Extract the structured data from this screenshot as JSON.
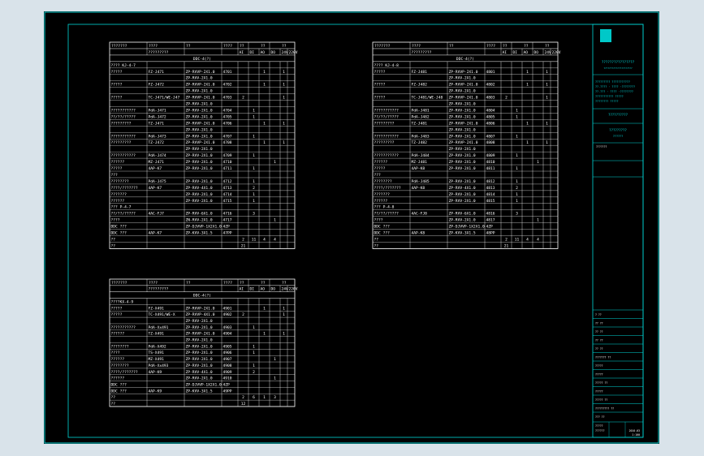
{
  "colors": {
    "frame_bg": "#d9e3ea",
    "sheet_bg": "#000000",
    "border": "#00d8d8",
    "lines": "#ffffff",
    "title_text": "#00e0e0",
    "logo_bg": "#00c8c8"
  },
  "tables": [
    {
      "id": "t1",
      "header": [
        "???????",
        "????",
        "??",
        "????",
        "??",
        "??",
        "??"
      ],
      "subheader": [
        "",
        "?????????",
        "",
        "",
        "AI",
        "DI",
        "AO",
        "DO",
        "24V",
        "220V"
      ],
      "section": "DDC-4(?)",
      "rows": [
        [
          "???? KJ-4-7",
          "",
          "",
          "",
          "",
          "",
          "",
          "",
          "",
          ""
        ],
        [
          "?????",
          "FZ-J471",
          "ZP-RVVP-2X1.0",
          "4701",
          "",
          "",
          "1",
          "",
          "1",
          ""
        ],
        [
          "",
          "",
          "ZP-RVV-2X1.0",
          "",
          "",
          "",
          "",
          "",
          "",
          ""
        ],
        [
          "?????",
          "FZ-J472",
          "ZP-RVVP-2X1.0",
          "4702",
          "",
          "",
          "1",
          "",
          "1",
          ""
        ],
        [
          "",
          "",
          "ZP-RVV-2X1.0",
          "",
          "",
          "",
          "",
          "",
          "",
          ""
        ],
        [
          "?????",
          "TC-J471/WE-J47",
          "ZP-RVVP-2X1.0",
          "4703",
          "2",
          "",
          "",
          "",
          "1",
          ""
        ],
        [
          "",
          "",
          "ZP-RVV-2X1.0",
          "",
          "",
          "",
          "",
          "",
          "",
          ""
        ],
        [
          "???????????",
          "PdA-J471",
          "ZP-RVV-2X1.0",
          "4704",
          "",
          "1",
          "",
          "",
          "",
          ""
        ],
        [
          "??/??/?????",
          "PdA-J472",
          "ZP-RVV-2X1.0",
          "4705",
          "",
          "1",
          "",
          "",
          "",
          ""
        ],
        [
          "?????????",
          "TZ-J471",
          "ZP-RVVP-2X1.0",
          "4706",
          "",
          "",
          "1",
          "",
          "1",
          ""
        ],
        [
          "",
          "",
          "ZP-RVV-2X1.0",
          "",
          "",
          "",
          "",
          "",
          "",
          ""
        ],
        [
          "???????????",
          "PdA-J473",
          "ZP-RVV-2X1.0",
          "4707",
          "",
          "1",
          "",
          "",
          "",
          ""
        ],
        [
          "?????????",
          "TZ-J472",
          "ZP-RVVP-2X1.0",
          "4708",
          "",
          "",
          "1",
          "",
          "1",
          ""
        ],
        [
          "",
          "",
          "ZP-RVV-2X1.0",
          "",
          "",
          "",
          "",
          "",
          "",
          ""
        ],
        [
          "???????????",
          "PdA-J474",
          "ZP-RVV-2X1.0",
          "4709",
          "",
          "1",
          "",
          "",
          "",
          ""
        ],
        [
          "??????",
          "MZ-J471",
          "ZP-RVV-2X1.0",
          "4710",
          "",
          "",
          "",
          "1",
          "",
          ""
        ],
        [
          "?????",
          "4AP-K7",
          "ZP-RVV-2X1.0",
          "4711",
          "",
          "1",
          "",
          "",
          "",
          ""
        ],
        [
          "???",
          "",
          "",
          "",
          "",
          "",
          "",
          "",
          "",
          ""
        ],
        [
          "????????",
          "PdA-J475",
          "ZP-RVV-2X1.0",
          "4712",
          "",
          "1",
          "",
          "",
          "",
          ""
        ],
        [
          "????/???????",
          "4AP-K7",
          "ZP-RVV-4X1.0",
          "4713",
          "",
          "2",
          "",
          "",
          "",
          ""
        ],
        [
          "???????",
          "",
          "ZP-RVV-2X1.0",
          "4714",
          "",
          "1",
          "",
          "",
          "",
          ""
        ],
        [
          "??????",
          "",
          "ZP-RVV-2X1.0",
          "4715",
          "",
          "1",
          "",
          "",
          "",
          ""
        ],
        [
          "??? P-4-7",
          "",
          "",
          "",
          "",
          "",
          "",
          "",
          "",
          ""
        ],
        [
          "??/??/?????",
          "4AC-FJ7",
          "ZP-RVV-6X1.0",
          "4716",
          "",
          "3",
          "",
          "",
          "",
          ""
        ],
        [
          "????",
          "",
          "ZN-RVV-2X1.0",
          "4717",
          "",
          "",
          "",
          "1",
          "",
          ""
        ],
        [
          "DDC ???",
          "",
          "ZP-DJVVP-1X2X1.0",
          "4ZP",
          "",
          "",
          "",
          "",
          "",
          ""
        ],
        [
          "DDC ???",
          "4AP-K7",
          "ZP-KVV-3X1.5",
          "47PP",
          "",
          "",
          "",
          "",
          "",
          ""
        ],
        [
          "??",
          "",
          "",
          "",
          "2",
          "11",
          "4",
          "4",
          "",
          ""
        ],
        [
          "??",
          "",
          "",
          "",
          "21",
          "",
          "",
          "",
          "",
          ""
        ]
      ]
    },
    {
      "id": "t2",
      "header": [
        "???????",
        "????",
        "??",
        "????",
        "??",
        "??",
        "??"
      ],
      "subheader": [
        "",
        "?????????",
        "",
        "",
        "AI",
        "DI",
        "AO",
        "DO",
        "24V",
        "220V"
      ],
      "section": "DDC-4(?)",
      "rows": [
        [
          "???? KJ-4-8",
          "",
          "",
          "",
          "",
          "",
          "",
          "",
          "",
          ""
        ],
        [
          "?????",
          "FZ-J481",
          "ZP-RVVP-2X1.0",
          "4801",
          "",
          "",
          "1",
          "",
          "1",
          ""
        ],
        [
          "",
          "",
          "ZP-RVV-2X1.0",
          "",
          "",
          "",
          "",
          "",
          "",
          ""
        ],
        [
          "?????",
          "FZ-J482",
          "ZP-RVVP-2X1.0",
          "4802",
          "",
          "",
          "1",
          "",
          "1",
          ""
        ],
        [
          "",
          "",
          "ZP-RVV-2X1.0",
          "",
          "",
          "",
          "",
          "",
          "",
          ""
        ],
        [
          "?????",
          "TC-J481/WE-J48",
          "ZP-RVVP-2X1.0",
          "4803",
          "2",
          "",
          "",
          "",
          "1",
          ""
        ],
        [
          "",
          "",
          "ZP-RVV-2X1.0",
          "",
          "",
          "",
          "",
          "",
          "",
          ""
        ],
        [
          "???????????",
          "PdA-J481",
          "ZP-RVV-2X1.0",
          "4804",
          "",
          "1",
          "",
          "",
          "",
          ""
        ],
        [
          "??/??/?????",
          "PdA-J482",
          "ZP-RVV-2X1.0",
          "4805",
          "",
          "1",
          "",
          "",
          "",
          ""
        ],
        [
          "?????????",
          "TZ-J481",
          "ZP-RVVP-2X1.0",
          "4806",
          "",
          "",
          "1",
          "",
          "1",
          ""
        ],
        [
          "",
          "",
          "ZP-RVV-2X1.0",
          "",
          "",
          "",
          "",
          "",
          "",
          ""
        ],
        [
          "???????????",
          "PdA-J483",
          "ZP-RVV-2X1.0",
          "4807",
          "",
          "1",
          "",
          "",
          "",
          ""
        ],
        [
          "?????????",
          "TZ-J482",
          "ZP-RVVP-2X1.0",
          "4808",
          "",
          "",
          "1",
          "",
          "1",
          ""
        ],
        [
          "",
          "",
          "ZP-RVV-2X1.0",
          "",
          "",
          "",
          "",
          "",
          "",
          ""
        ],
        [
          "???????????",
          "PdA-J484",
          "ZP-RVV-2X1.0",
          "4809",
          "",
          "1",
          "",
          "",
          "",
          ""
        ],
        [
          "??????",
          "MZ-J481",
          "ZP-RVV-2X1.0",
          "4810",
          "",
          "",
          "",
          "1",
          "",
          ""
        ],
        [
          "?????",
          "4AP-K8",
          "ZP-RVV-2X1.0",
          "4811",
          "",
          "1",
          "",
          "",
          "",
          ""
        ],
        [
          "???",
          "",
          "",
          "",
          "",
          "",
          "",
          "",
          "",
          ""
        ],
        [
          "????????",
          "PdA-J485",
          "ZP-RVV-2X1.0",
          "4812",
          "",
          "1",
          "",
          "",
          "",
          ""
        ],
        [
          "????/???????",
          "4AP-K8",
          "ZP-RVV-4X1.0",
          "4813",
          "",
          "2",
          "",
          "",
          "",
          ""
        ],
        [
          "???????",
          "",
          "ZP-RVV-2X1.0",
          "4814",
          "",
          "1",
          "",
          "",
          "",
          ""
        ],
        [
          "??????",
          "",
          "ZP-RVV-2X1.0",
          "4815",
          "",
          "1",
          "",
          "",
          "",
          ""
        ],
        [
          "??? P-4-8",
          "",
          "",
          "",
          "",
          "",
          "",
          "",
          "",
          ""
        ],
        [
          "??/??/?????",
          "4AC-FJ8",
          "ZP-RVV-6X1.0",
          "4816",
          "",
          "3",
          "",
          "",
          "",
          ""
        ],
        [
          "????",
          "",
          "ZP-RVV-2X1.0",
          "4817",
          "",
          "",
          "",
          "1",
          "",
          ""
        ],
        [
          "DDC ???",
          "",
          "ZP-DJVVP-1X2X1.0",
          "4ZP",
          "",
          "",
          "",
          "",
          "",
          ""
        ],
        [
          "DDC ???",
          "4AP-K8",
          "ZP-KVV-3X1.5",
          "48PP",
          "",
          "",
          "",
          "",
          "",
          ""
        ],
        [
          "??",
          "",
          "",
          "",
          "2",
          "11",
          "4",
          "4",
          "",
          ""
        ],
        [
          "??",
          "",
          "",
          "",
          "21",
          "",
          "",
          "",
          "",
          ""
        ]
      ]
    },
    {
      "id": "t3",
      "header": [
        "???????",
        "????",
        "??",
        "????",
        "??",
        "??",
        "??"
      ],
      "subheader": [
        "",
        "?????????",
        "",
        "",
        "AI",
        "DI",
        "AO",
        "DO",
        "24V",
        "220V"
      ],
      "section": "DDC-4(?)",
      "rows": [
        [
          "????KX-4-9",
          "",
          "",
          "",
          "",
          "",
          "",
          "",
          "",
          ""
        ],
        [
          "?????",
          "FZ-X491",
          "ZP-RVVP-2X1.0",
          "4901",
          "",
          "",
          "1",
          "",
          "1",
          ""
        ],
        [
          "?????",
          "TC-X491/WE-X",
          "ZP-RVVP-4X1.0",
          "4902",
          "2",
          "",
          "",
          "",
          "1",
          ""
        ],
        [
          "",
          "",
          "ZP-RVV-2X1.0",
          "",
          "",
          "",
          "",
          "",
          "",
          ""
        ],
        [
          "???????????",
          "PdA-Xx491",
          "ZP-RVV-2X1.0",
          "4903",
          "",
          "1",
          "",
          "",
          "",
          ""
        ],
        [
          "??????",
          "TZ-X491",
          "ZP-RVVP-2X1.0",
          "4904",
          "",
          "",
          "1",
          "",
          "1",
          ""
        ],
        [
          "",
          "",
          "ZP-RVV-2X1.0",
          "",
          "",
          "",
          "",
          "",
          "",
          ""
        ],
        [
          "????????",
          "PdA-X492",
          "ZP-RVV-2X1.0",
          "4905",
          "",
          "1",
          "",
          "",
          "",
          ""
        ],
        [
          "????",
          "TS-X491",
          "ZP-RVV-2X1.0",
          "4906",
          "",
          "1",
          "",
          "",
          "",
          ""
        ],
        [
          "??????",
          "MZ-X491",
          "ZP-RVV-2X1.0",
          "4907",
          "",
          "",
          "",
          "1",
          "",
          ""
        ],
        [
          "????????",
          "PdA-Xx493",
          "ZP-RVV-2X1.0",
          "4908",
          "",
          "1",
          "",
          "",
          "",
          ""
        ],
        [
          "????/???????",
          "4AP-K9",
          "ZP-RVV-4X1.0",
          "4909",
          "",
          "2",
          "",
          "",
          "",
          ""
        ],
        [
          "??????",
          "",
          "ZP-RVV-2X1.0",
          "4910",
          "",
          "",
          "",
          "1",
          "",
          ""
        ],
        [
          "DDC ???",
          "",
          "ZP-DJVVP-1X2X1.0",
          "4ZP",
          "",
          "",
          "",
          "",
          "",
          ""
        ],
        [
          "DDC ???",
          "4AP-K9",
          "ZP-KVV-3X1.5",
          "49PP",
          "",
          "",
          "",
          "",
          "",
          ""
        ],
        [
          "??",
          "",
          "",
          "",
          "2",
          "6",
          "1",
          "3",
          "",
          ""
        ],
        [
          "??",
          "",
          "",
          "",
          "12",
          "",
          "",
          "",
          "",
          ""
        ]
      ]
    }
  ],
  "title_block": {
    "company": "????????????????",
    "company_sub": "?????????????????????",
    "notes": [
      "????????? ???????????",
      "??.???? · ???? ·????????",
      "??.??? · ???? ·????????",
      "??????????? ?????",
      "???????? ?????"
    ],
    "drawing_name": "??????????",
    "project": "?????????",
    "project_sub": "??????",
    "seal_text": "???????",
    "rows_mid": [
      "? ??",
      "?? ??",
      "?? ??",
      "?? ??",
      "?? ??",
      "??????? ??",
      "?????",
      "?????",
      "????? ??",
      "?????",
      "????? ??",
      "????????? ??",
      "??? ??"
    ],
    "drawing_no": "?????",
    "sheet_info": "??????",
    "scale": "1:100",
    "date": "2010.03"
  }
}
